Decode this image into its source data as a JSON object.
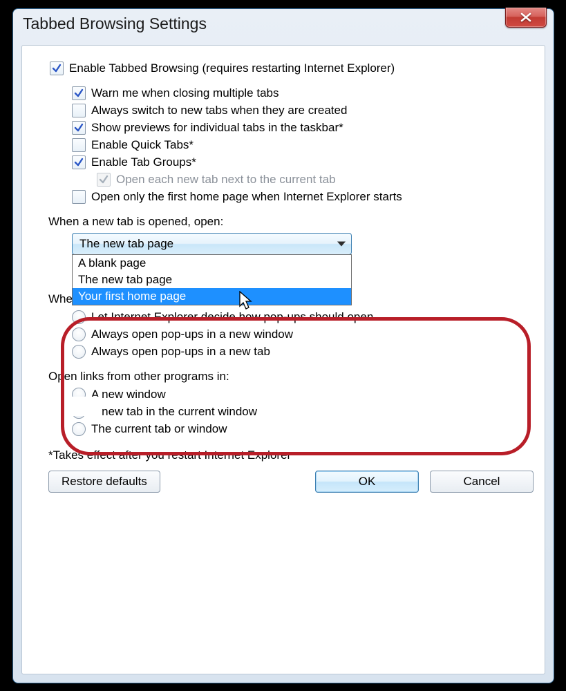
{
  "title": "Tabbed Browsing Settings",
  "checkboxes": {
    "enable": {
      "label": "Enable Tabbed Browsing (requires restarting Internet Explorer)",
      "checked": true
    },
    "warn": {
      "label": "Warn me when closing multiple tabs",
      "checked": true
    },
    "switch": {
      "label": "Always switch to new tabs when they are created",
      "checked": false
    },
    "previews": {
      "label": "Show previews for individual tabs in the taskbar*",
      "checked": true
    },
    "quick": {
      "label": "Enable Quick Tabs*",
      "checked": false
    },
    "groups": {
      "label": "Enable Tab Groups*",
      "checked": true
    },
    "nextto": {
      "label": "Open each new tab next to the current tab",
      "checked": true,
      "disabled": true
    },
    "firsthome": {
      "label": "Open only the first home page when Internet Explorer starts",
      "checked": false
    }
  },
  "newtab": {
    "group_label": "When a new tab is opened, open:",
    "selected": "The new tab page",
    "options": [
      "A blank page",
      "The new tab page",
      "Your first home page"
    ],
    "highlighted_index": 2
  },
  "popups": {
    "group_label": "When a pop-up is encountered:",
    "options": [
      {
        "label": "Let Internet Explorer decide how pop-ups should open",
        "checked": false
      },
      {
        "label": "Always open pop-ups in a new window",
        "checked": false
      },
      {
        "label": "Always open pop-ups in a new tab",
        "checked": false
      }
    ]
  },
  "links": {
    "group_label": "Open links from other programs in:",
    "options": [
      {
        "label": "A new window",
        "checked": false
      },
      {
        "label": "A new tab in the current window",
        "checked": true
      },
      {
        "label": "The current tab or window",
        "checked": false
      }
    ]
  },
  "footnote": "*Takes effect after you restart Internet Explorer",
  "buttons": {
    "restore": "Restore defaults",
    "ok": "OK",
    "cancel": "Cancel"
  }
}
